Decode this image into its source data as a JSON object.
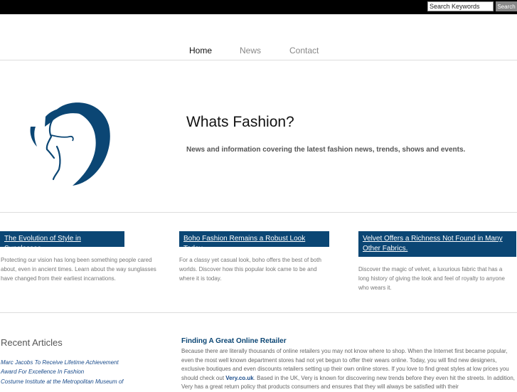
{
  "search": {
    "placeholder": "Search Keywords",
    "value": "Search Keywords",
    "button_label": "Search"
  },
  "nav": {
    "items": [
      {
        "label": "Home"
      },
      {
        "label": "News"
      },
      {
        "label": "Contact"
      }
    ],
    "active": "Home"
  },
  "hero": {
    "title": "Whats Fashion?",
    "subtitle": "News and information covering the latest fashion news, trends, shows and events.",
    "logo_color": "#0b4674"
  },
  "features": [
    {
      "title": "The Evolution of Style in Sunglasses.",
      "text": "Protecting our vision has long been something people cared about, even in ancient times. Learn about the way sunglasses have changed from their earliest incarnations."
    },
    {
      "title": "Boho Fashion Remains a Robust Look Today.",
      "text": "For a classy yet casual look, boho offers the best of both worlds. Discover how this popular look came to be and where it is today."
    },
    {
      "title": "Velvet Offers a Richness Not Found in Many Other Fabrics.",
      "text": "Discover the magic of velvet, a luxurious fabric that has a long history of giving the look and feel of royalty to anyone who wears it."
    }
  ],
  "recent": {
    "heading": "Recent Articles",
    "links": [
      "Marc Jacobs To Receive Lifetime Achievement",
      "Award For Excellence In Fashion",
      "Costume Institute at the Metropolitan Museum of"
    ]
  },
  "article": {
    "title": "Finding A Great Online Retailer",
    "body_pre": "Because there are literally thousands of online retailers you may not know where to shop. When the Internet first became popular, even the most well known department stores had not yet begun to offer their wears online. Today, you will find new designers, exclusive boutiques and even discounts retailers setting up their own online stores. If you love to find great styles at low prices you should check out",
    "link_text": "Very.co.uk",
    "body_post": ". Based in the UK, Very is known for discovering new trends before they even hit the streets. In addition, Very has a great return policy that products consumers and ensures that they will always be satisfied with their"
  },
  "colors": {
    "topbar": "#000000",
    "accent": "#0b4674",
    "link": "#1a4c8b"
  }
}
